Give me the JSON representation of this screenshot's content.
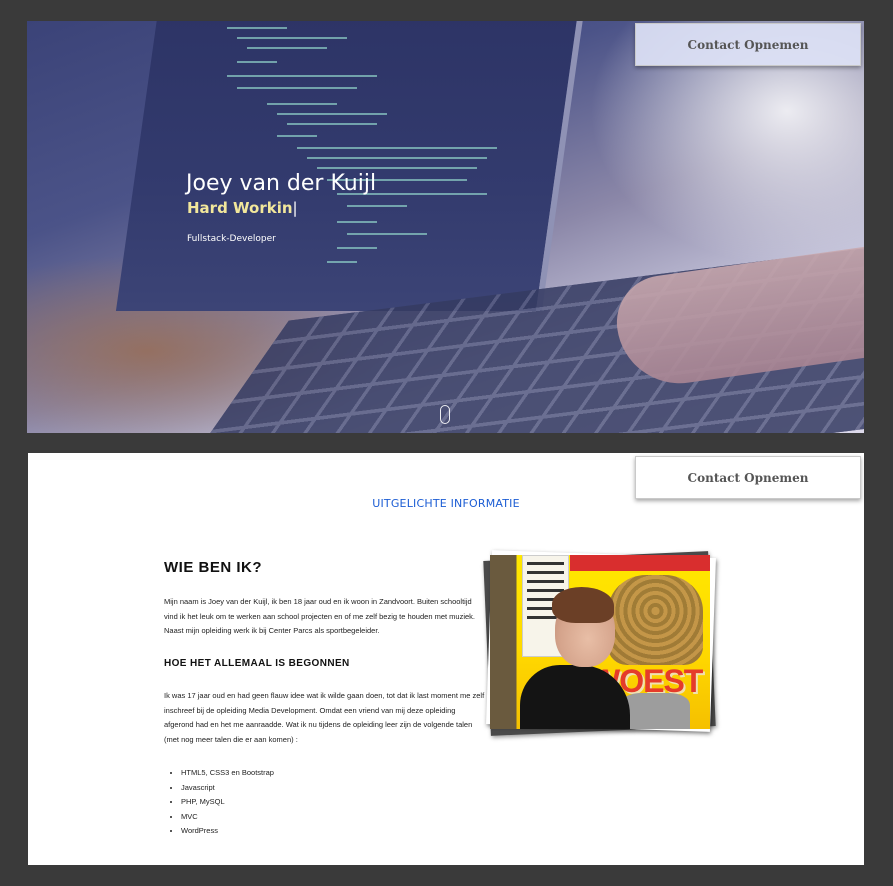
{
  "hero": {
    "name": "Joey van der Kuijl",
    "typed_text": "Hard Workin",
    "cursor": "|",
    "role": "Fullstack-Developer",
    "contact_label": "Contact Opnemen"
  },
  "content": {
    "contact_label": "Contact Opnemen",
    "featured_label": "UITGELICHTE INFORMATIE",
    "about_title": "WIE BEN IK?",
    "about_paragraph": "Mijn naam is Joey van der Kuijl, ik ben 18 jaar oud en ik woon in Zandvoort. Buiten schooltijd vind ik het leuk om te werken aan school projecten en of me zelf bezig te houden met muziek. Naast mijn opleiding werk ik bij Center Parcs als sportbegeleider.",
    "subtitle": "HOE HET ALLEMAAL IS BEGONNEN",
    "story_paragraph": "Ik was 17 jaar oud en had geen flauw idee wat ik wilde gaan doen, tot dat ik last moment me zelf inschreef bij de opleiding Media Development. Omdat een vriend van mij deze opleiding afgerond had en het me aanraadde. Wat ik nu tijdens de opleiding leer zijn de volgende talen (met nog meer talen die er aan komen) :",
    "languages": [
      "HTML5, CSS3 en Bootstrap",
      "Javascript",
      "PHP, MySQL",
      "MVC",
      "WordPress"
    ],
    "photo_poster_text": "WOEST"
  },
  "colors": {
    "typed_text": "#f2e79b",
    "featured_link": "#1c5dd4",
    "frame_background": "#3a3a3a"
  }
}
